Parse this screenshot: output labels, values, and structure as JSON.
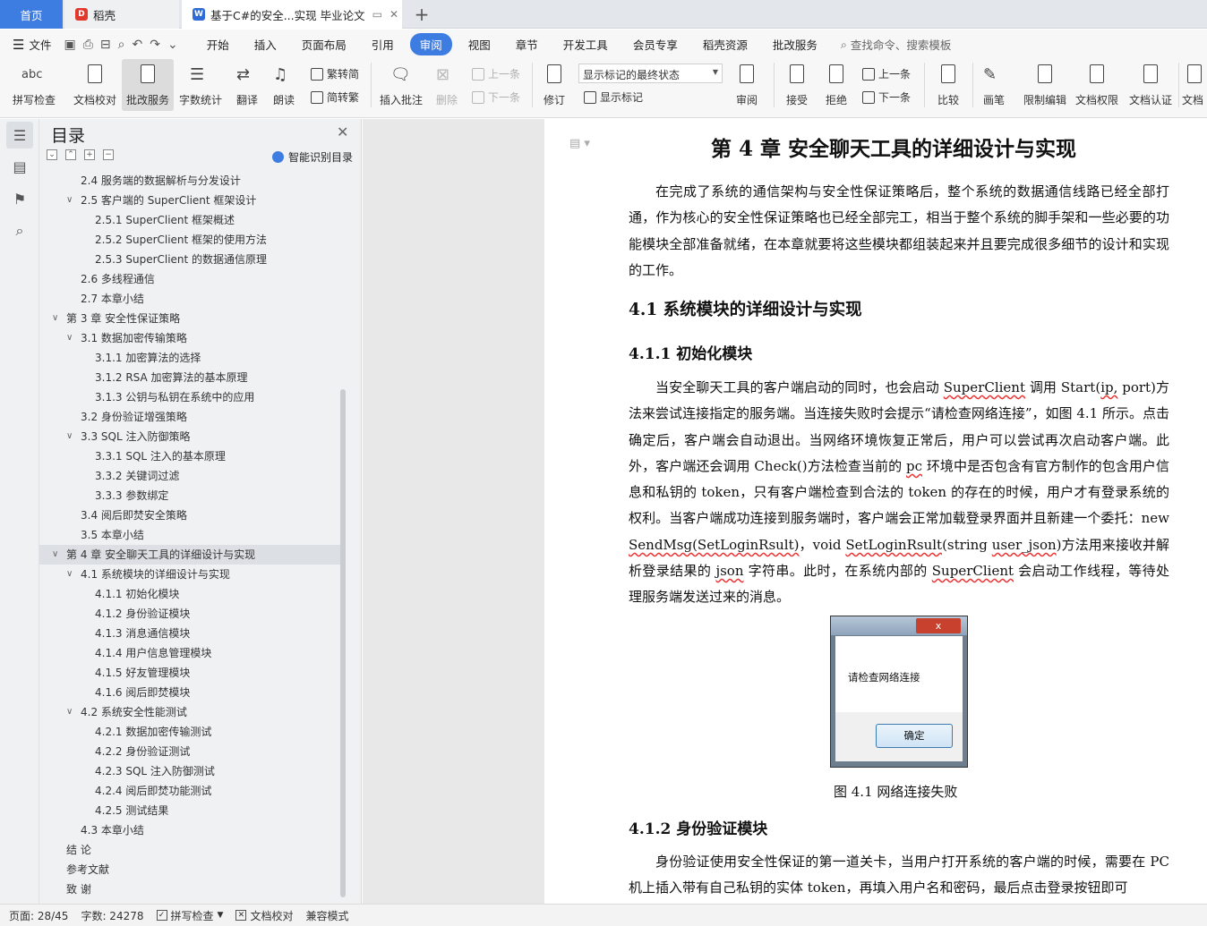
{
  "tabs": {
    "home": "首页",
    "docer": "稻壳",
    "document": "基于C#的安全...实现 毕业论文",
    "new_tab": "+"
  },
  "menubar": {
    "file": "文件",
    "items": [
      "开始",
      "插入",
      "页面布局",
      "引用",
      "审阅",
      "视图",
      "章节",
      "开发工具",
      "会员专享",
      "稻壳资源",
      "批改服务"
    ],
    "active": "审阅",
    "search": "查找命令、搜索模板"
  },
  "ribbon": {
    "spell_check": "拼写检查",
    "doc_proof": "文档校对",
    "review_service": "批改服务",
    "word_count": "字数统计",
    "translate": "翻译",
    "read_aloud": "朗读",
    "to_traditional": "繁转简",
    "to_simplified": "简转繁",
    "insert_comment": "插入批注",
    "delete": "删除",
    "prev": "上一条",
    "next": "下一条",
    "track_changes": "修订",
    "markup_select": "显示标记的最终状态",
    "show_markup": "显示标记",
    "review": "审阅",
    "accept": "接受",
    "reject": "拒绝",
    "prev2": "上一条",
    "next2": "下一条",
    "compare": "比较",
    "pen": "画笔",
    "restrict_edit": "限制编辑",
    "doc_permission": "文档权限",
    "doc_cert": "文档认证",
    "doc_more": "文档"
  },
  "toc": {
    "title": "目录",
    "smart": "智能识别目录",
    "items": [
      {
        "label": "2.4  服务端的数据解析与分发设计",
        "level": 2,
        "arrow": false
      },
      {
        "label": "2.5  客户端的 SuperClient 框架设计",
        "level": 2,
        "arrow": true
      },
      {
        "label": "2.5.1 SuperClient 框架概述",
        "level": 3,
        "arrow": false
      },
      {
        "label": "2.5.2 SuperClient 框架的使用方法",
        "level": 3,
        "arrow": false
      },
      {
        "label": "2.5.3 SuperClient 的数据通信原理",
        "level": 3,
        "arrow": false
      },
      {
        "label": "2.6  多线程通信",
        "level": 2,
        "arrow": false
      },
      {
        "label": "2.7  本章小结",
        "level": 2,
        "arrow": false
      },
      {
        "label": "第 3 章  安全性保证策略",
        "level": 1,
        "arrow": true
      },
      {
        "label": "3.1  数据加密传输策略",
        "level": 2,
        "arrow": true
      },
      {
        "label": "3.1.1  加密算法的选择",
        "level": 3,
        "arrow": false
      },
      {
        "label": "3.1.2 RSA 加密算法的基本原理",
        "level": 3,
        "arrow": false
      },
      {
        "label": "3.1.3  公钥与私钥在系统中的应用",
        "level": 3,
        "arrow": false
      },
      {
        "label": "3.2  身份验证增强策略",
        "level": 2,
        "arrow": false
      },
      {
        "label": "3.3 SQL 注入防御策略",
        "level": 2,
        "arrow": true
      },
      {
        "label": "3.3.1 SQL 注入的基本原理",
        "level": 3,
        "arrow": false
      },
      {
        "label": "3.3.2  关键词过滤",
        "level": 3,
        "arrow": false
      },
      {
        "label": "3.3.3  参数绑定",
        "level": 3,
        "arrow": false
      },
      {
        "label": "3.4  阅后即焚安全策略",
        "level": 2,
        "arrow": false
      },
      {
        "label": "3.5  本章小结",
        "level": 2,
        "arrow": false
      },
      {
        "label": "第 4 章  安全聊天工具的详细设计与实现",
        "level": 1,
        "arrow": true,
        "active": true
      },
      {
        "label": "4.1  系统模块的详细设计与实现",
        "level": 2,
        "arrow": true
      },
      {
        "label": "4.1.1  初始化模块",
        "level": 3,
        "arrow": false
      },
      {
        "label": "4.1.2  身份验证模块",
        "level": 3,
        "arrow": false
      },
      {
        "label": "4.1.3  消息通信模块",
        "level": 3,
        "arrow": false
      },
      {
        "label": "4.1.4  用户信息管理模块",
        "level": 3,
        "arrow": false
      },
      {
        "label": "4.1.5  好友管理模块",
        "level": 3,
        "arrow": false
      },
      {
        "label": "4.1.6  阅后即焚模块",
        "level": 3,
        "arrow": false
      },
      {
        "label": "4.2  系统安全性能测试",
        "level": 2,
        "arrow": true
      },
      {
        "label": "4.2.1  数据加密传输测试",
        "level": 3,
        "arrow": false
      },
      {
        "label": "4.2.2  身份验证测试",
        "level": 3,
        "arrow": false
      },
      {
        "label": "4.2.3 SQL 注入防御测试",
        "level": 3,
        "arrow": false
      },
      {
        "label": "4.2.4  阅后即焚功能测试",
        "level": 3,
        "arrow": false
      },
      {
        "label": "4.2.5  测试结果",
        "level": 3,
        "arrow": false
      },
      {
        "label": "4.3  本章小结",
        "level": 2,
        "arrow": false
      },
      {
        "label": "结    论",
        "level": 1,
        "arrow": false
      },
      {
        "label": "参考文献",
        "level": 1,
        "arrow": false
      },
      {
        "label": "致    谢",
        "level": 1,
        "arrow": false
      }
    ]
  },
  "document": {
    "chapter_title": "第 4 章  安全聊天工具的详细设计与实现",
    "intro": "在完成了系统的通信架构与安全性保证策略后，整个系统的数据通信线路已经全部打通，作为核心的安全性保证策略也已经全部完工，相当于整个系统的脚手架和一些必要的功能模块全部准备就绪，在本章就要将这些模块都组装起来并且要完成很多细节的设计和实现的工作。",
    "h_4_1": "4.1  系统模块的详细设计与实现",
    "h_4_1_1": "4.1.1  初始化模块",
    "p_4_1_1_a": "当安全聊天工具的客户端启动的同时，也会启动 ",
    "p_4_1_1_sc1": "SuperClient",
    "p_4_1_1_b": " 调用 Start(",
    "p_4_1_1_ip": "ip,",
    "p_4_1_1_c": " port)方法来尝试连接指定的服务端。当连接失败时会提示“请检查网络连接”，如图 4.1 所示。点击确定后，客户端会自动退出。当网络环境恢复正常后，用户可以尝试再次启动客户端。此外，客户端还会调用 Check()方法检查当前的 ",
    "p_4_1_1_pc": "pc",
    "p_4_1_1_d": " 环境中是否包含有官方制作的包含用户信息和私钥的 token，只有客户端检查到合法的 token 的存在的时候，用户才有登录系统的权利。当客户端成功连接到服务端时，客户端会正常加载登录界面并且新建一个委托：new ",
    "p_4_1_1_sm": "SendMsg(SetLoginRsult)",
    "p_4_1_1_e": "，void ",
    "p_4_1_1_slr": "SetLoginRsult",
    "p_4_1_1_f": "(string ",
    "p_4_1_1_uj": "user_json",
    "p_4_1_1_g": ")方法用来接收并解析登录结果的 ",
    "p_4_1_1_json": "json",
    "p_4_1_1_h": " 字符串。此时，在系统内部的 ",
    "p_4_1_1_sc2": "SuperClient",
    "p_4_1_1_i": " 会启动工作线程，等待处理服务端发送过来的消息。",
    "dialog_close": "x",
    "dialog_message": "请检查网络连接",
    "dialog_ok": "确定",
    "figure_caption": "图 4.1  网络连接失败",
    "h_4_1_2": "4.1.2  身份验证模块",
    "p_4_1_2": "身份验证使用安全性保证的第一道关卡，当用户打开系统的客户端的时候，需要在 PC 机上插入带有自己私钥的实体 token，再填入用户名和密码，最后点击登录按钮即可"
  },
  "statusbar": {
    "page": "页面: 28/45",
    "words": "字数: 24278",
    "spell_check": "拼写检查",
    "doc_proof": "文档校对",
    "compat_mode": "兼容模式"
  }
}
